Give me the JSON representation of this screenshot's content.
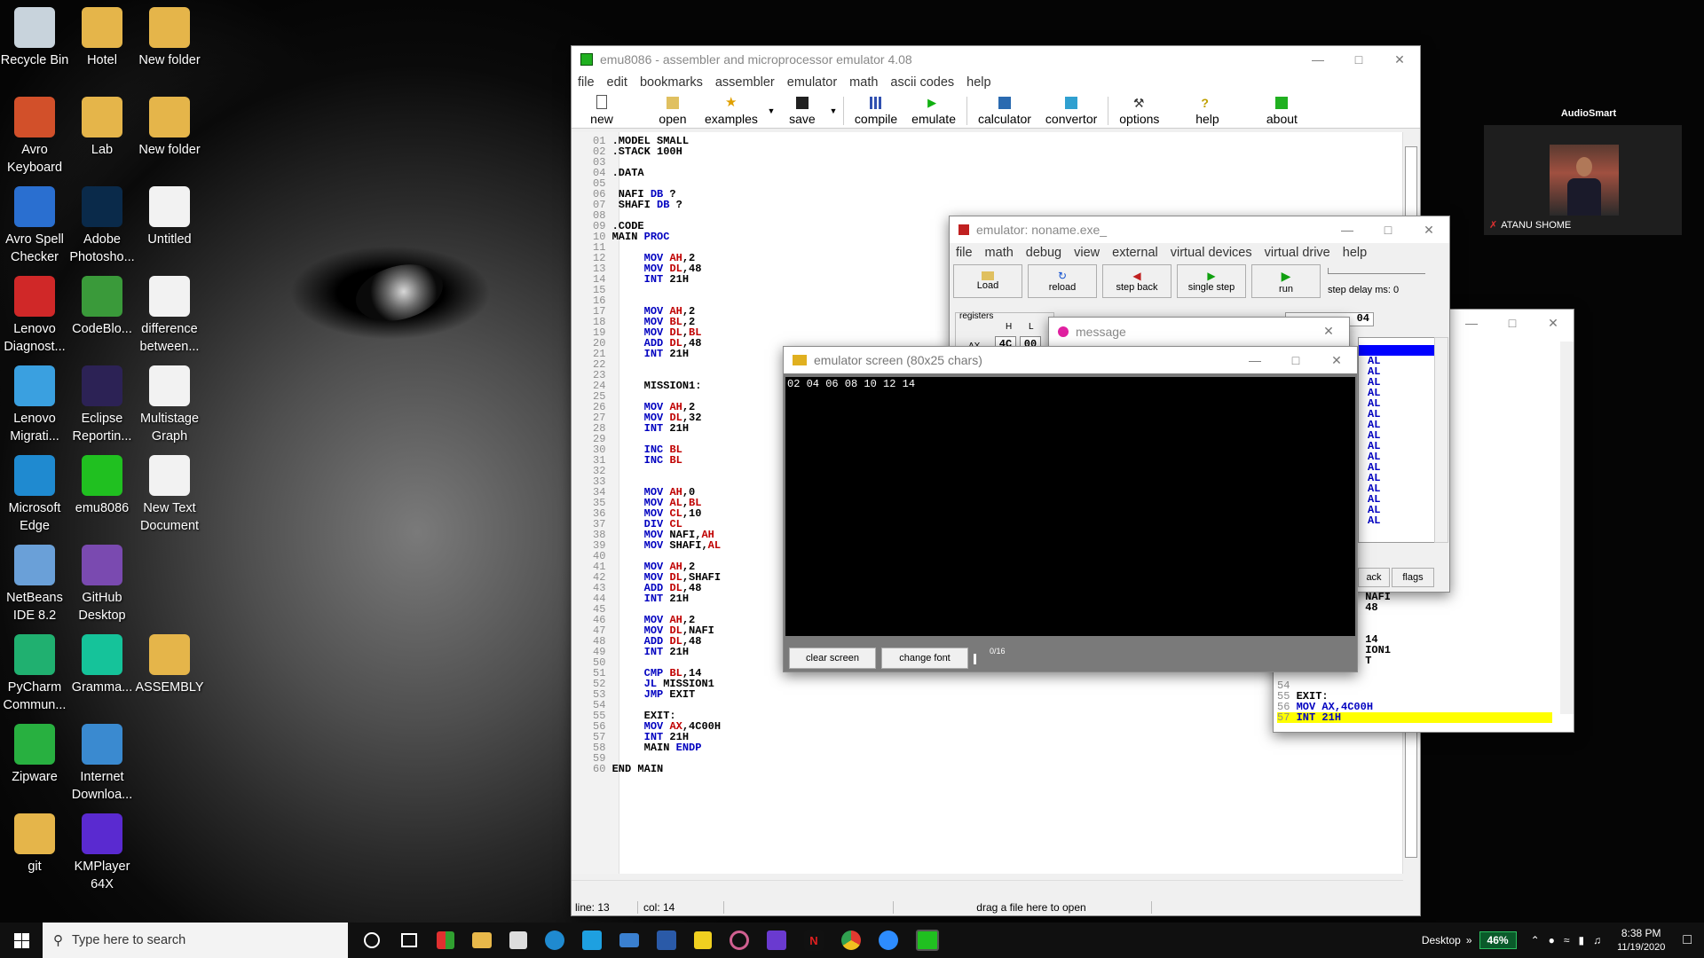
{
  "desktop": {
    "icons": [
      {
        "label": "Recycle Bin",
        "color": "#c8d3dc"
      },
      {
        "label": "Hotel",
        "color": "#e5b54a"
      },
      {
        "label": "New folder",
        "color": "#e5b54a"
      },
      {
        "label": "Avro Keyboard",
        "color": "#d2502a"
      },
      {
        "label": "Lab",
        "color": "#e5b54a"
      },
      {
        "label": "New folder",
        "color": "#e5b54a"
      },
      {
        "label": "Avro Spell Checker",
        "color": "#2a6fd0"
      },
      {
        "label": "Adobe Photosho...",
        "color": "#0a2a4a"
      },
      {
        "label": "Untitled",
        "color": "#f2f2f2"
      },
      {
        "label": "Lenovo Diagnost...",
        "color": "#d02828"
      },
      {
        "label": "CodeBlo...",
        "color": "#3a9a3a"
      },
      {
        "label": "difference between...",
        "color": "#f2f2f2"
      },
      {
        "label": "Lenovo Migrati...",
        "color": "#3aa0e0"
      },
      {
        "label": "Eclipse Reportin...",
        "color": "#2c2255"
      },
      {
        "label": "Multistage Graph",
        "color": "#f2f2f2"
      },
      {
        "label": "Microsoft Edge",
        "color": "#1f8ad0"
      },
      {
        "label": "emu8086",
        "color": "#20c020"
      },
      {
        "label": "New Text Document",
        "color": "#f2f2f2"
      },
      {
        "label": "NetBeans IDE 8.2",
        "color": "#6aa0d8"
      },
      {
        "label": "GitHub Desktop",
        "color": "#7a4ab0"
      },
      {
        "label": "PyCharm Commun...",
        "color": "#20b070"
      },
      {
        "label": "Gramma...",
        "color": "#15c39a"
      },
      {
        "label": "ASSEMBLY",
        "color": "#e5b54a"
      },
      {
        "label": "Zipware",
        "color": "#28b040"
      },
      {
        "label": "Internet Downloa...",
        "color": "#3a8ad0"
      },
      {
        "label": "git",
        "color": "#e5b54a"
      },
      {
        "label": "KMPlayer 64X",
        "color": "#5a2ad0"
      }
    ]
  },
  "emu_main": {
    "title": "emu8086 - assembler and microprocessor emulator 4.08",
    "menu": [
      "file",
      "edit",
      "bookmarks",
      "assembler",
      "emulator",
      "math",
      "ascii codes",
      "help"
    ],
    "toolbar": [
      "new",
      "open",
      "examples",
      "save",
      "compile",
      "emulate",
      "calculator",
      "convertor",
      "options",
      "help",
      "about"
    ],
    "status": {
      "line": "line: 13",
      "col": "col: 14",
      "hint": "drag a file here to open"
    }
  },
  "code_lines": [
    {
      "n": "01",
      "c": ".MODEL SMALL"
    },
    {
      "n": "02",
      "c": ".STACK 100H"
    },
    {
      "n": "03",
      "c": ""
    },
    {
      "n": "04",
      "c": ".DATA"
    },
    {
      "n": "05",
      "c": ""
    },
    {
      "n": "06",
      "c": " NAFI DB ?"
    },
    {
      "n": "07",
      "c": " SHAFI DB ?"
    },
    {
      "n": "08",
      "c": ""
    },
    {
      "n": "09",
      "c": ".CODE"
    },
    {
      "n": "10",
      "c": "MAIN PROC"
    },
    {
      "n": "11",
      "c": ""
    },
    {
      "n": "12",
      "c": "     MOV AH,2"
    },
    {
      "n": "13",
      "c": "     MOV DL,48"
    },
    {
      "n": "14",
      "c": "     INT 21H"
    },
    {
      "n": "15",
      "c": ""
    },
    {
      "n": "16",
      "c": ""
    },
    {
      "n": "17",
      "c": "     MOV AH,2"
    },
    {
      "n": "18",
      "c": "     MOV BL,2"
    },
    {
      "n": "19",
      "c": "     MOV DL,BL"
    },
    {
      "n": "20",
      "c": "     ADD DL,48"
    },
    {
      "n": "21",
      "c": "     INT 21H"
    },
    {
      "n": "22",
      "c": ""
    },
    {
      "n": "23",
      "c": ""
    },
    {
      "n": "24",
      "c": "     MISSION1:"
    },
    {
      "n": "25",
      "c": ""
    },
    {
      "n": "26",
      "c": "     MOV AH,2"
    },
    {
      "n": "27",
      "c": "     MOV DL,32"
    },
    {
      "n": "28",
      "c": "     INT 21H"
    },
    {
      "n": "29",
      "c": ""
    },
    {
      "n": "30",
      "c": "     INC BL"
    },
    {
      "n": "31",
      "c": "     INC BL"
    },
    {
      "n": "32",
      "c": ""
    },
    {
      "n": "33",
      "c": ""
    },
    {
      "n": "34",
      "c": "     MOV AH,0"
    },
    {
      "n": "35",
      "c": "     MOV AL,BL"
    },
    {
      "n": "36",
      "c": "     MOV CL,10"
    },
    {
      "n": "37",
      "c": "     DIV CL"
    },
    {
      "n": "38",
      "c": "     MOV NAFI,AH"
    },
    {
      "n": "39",
      "c": "     MOV SHAFI,AL"
    },
    {
      "n": "40",
      "c": ""
    },
    {
      "n": "41",
      "c": "     MOV AH,2"
    },
    {
      "n": "42",
      "c": "     MOV DL,SHAFI"
    },
    {
      "n": "43",
      "c": "     ADD DL,48"
    },
    {
      "n": "44",
      "c": "     INT 21H"
    },
    {
      "n": "45",
      "c": ""
    },
    {
      "n": "46",
      "c": "     MOV AH,2"
    },
    {
      "n": "47",
      "c": "     MOV DL,NAFI"
    },
    {
      "n": "48",
      "c": "     ADD DL,48"
    },
    {
      "n": "49",
      "c": "     INT 21H"
    },
    {
      "n": "50",
      "c": ""
    },
    {
      "n": "51",
      "c": "     CMP BL,14"
    },
    {
      "n": "52",
      "c": "     JL MISSION1"
    },
    {
      "n": "53",
      "c": "     JMP EXIT"
    },
    {
      "n": "54",
      "c": ""
    },
    {
      "n": "55",
      "c": "     EXIT:"
    },
    {
      "n": "56",
      "c": "     MOV AX,4C00H"
    },
    {
      "n": "57",
      "c": "     INT 21H"
    },
    {
      "n": "58",
      "c": "     MAIN ENDP"
    },
    {
      "n": "59",
      "c": ""
    },
    {
      "n": "60",
      "c": "END MAIN"
    }
  ],
  "emulator": {
    "title": "emulator: noname.exe_",
    "menu": [
      "file",
      "math",
      "debug",
      "view",
      "external",
      "virtual devices",
      "virtual drive",
      "help"
    ],
    "buttons": [
      "Load",
      "reload",
      "step back",
      "single step",
      "run"
    ],
    "step_delay": "step delay ms: 0",
    "registers_label": "registers",
    "reg_h": "H",
    "reg_l": "L",
    "ax_label": "AX",
    "ax_h": "4C",
    "ax_l": "00",
    "right_field": "04",
    "disasm": [
      "AL",
      "AL",
      "AL",
      "AL",
      "AL",
      "AL",
      "AL",
      "AL",
      "AL",
      "AL",
      "AL",
      "AL",
      "AL",
      "AL",
      "AL",
      "AL"
    ],
    "bottom_buttons": [
      "ack",
      "flags"
    ]
  },
  "message": {
    "title": "message"
  },
  "screen": {
    "title": "emulator screen (80x25 chars)",
    "output": "02 04 06 08 10 12 14",
    "clear_btn": "clear screen",
    "font_btn": "change font",
    "counter": "0/16"
  },
  "source_win": {
    "lines_top": [
      " NAFI",
      " 48",
      "",
      "",
      " 14",
      " ION1",
      " T"
    ],
    "lines": [
      {
        "n": "54",
        "c": ""
      },
      {
        "n": "55",
        "c": "EXIT:"
      },
      {
        "n": "56",
        "c": "MOV AX,4C00H"
      },
      {
        "n": "57",
        "c": "INT 21H"
      }
    ]
  },
  "zoom": {
    "app": "AudioSmart",
    "name": "ATANU SHOME"
  },
  "taskbar": {
    "search_placeholder": "Type here to search",
    "desktop_label": "Desktop",
    "battery": "46%",
    "time": "8:38 PM",
    "date": "11/19/2020"
  },
  "colors": {
    "highlight_yellow": "#ffff00",
    "selection_blue": "#0000ff",
    "keyword_blue": "#0000c0",
    "register_red": "#c00000"
  }
}
